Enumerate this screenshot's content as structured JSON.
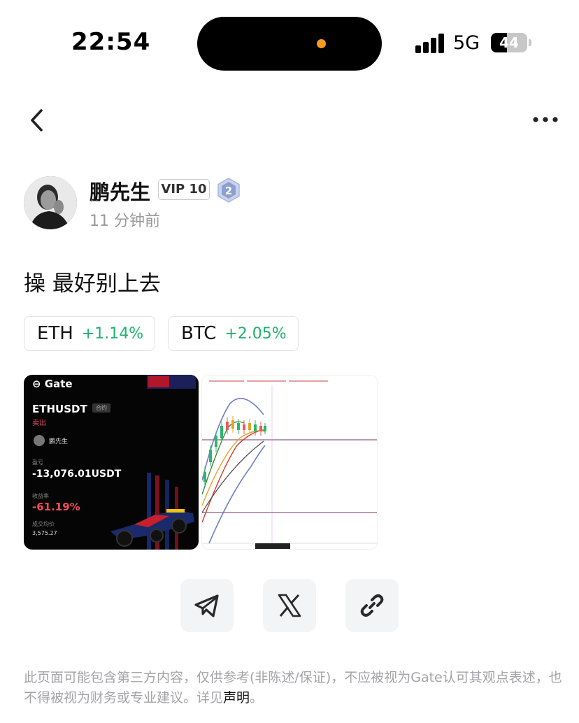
{
  "status_bar": {
    "time": "22:54",
    "network": "5G",
    "battery": "44",
    "battery_level": 0.44,
    "indicator_color": "#f59a1c"
  },
  "nav": {
    "back_icon": "chevron-left-icon",
    "more_icon": "more-horizontal-icon"
  },
  "author": {
    "name": "鹏先生",
    "vip": "VIP 10",
    "level": "2",
    "time_ago": "11 分钟前"
  },
  "post": {
    "text": "操 最好别上去",
    "coins": [
      {
        "symbol": "ETH",
        "change": "+1.14%"
      },
      {
        "symbol": "BTC",
        "change": "+2.05%"
      }
    ]
  },
  "trade_card": {
    "logo": "Gate",
    "pair": "ETHUSDT",
    "tag": "合约",
    "side": "卖出",
    "user": "鹏先生",
    "pnl_label": "盈亏",
    "pnl": "-13,076.01USDT",
    "roi_label": "收益率",
    "roi": "-61.19%",
    "avg_label": "成交均价",
    "avg_price": "3,575.27",
    "loss_color": "#ef4b5c"
  },
  "share": {
    "telegram_icon": "telegram-icon",
    "x_icon": "x-icon",
    "link_icon": "link-icon"
  },
  "disclaimer": {
    "text": "此页面可能包含第三方内容，仅供参考(非陈述/保证)，不应被视为Gate认可其观点表述，也不得被视为财务或专业建议。详见",
    "link": "声明",
    "end": "。"
  },
  "colors": {
    "positive": "#20b26c",
    "muted": "#a3a3a8"
  }
}
